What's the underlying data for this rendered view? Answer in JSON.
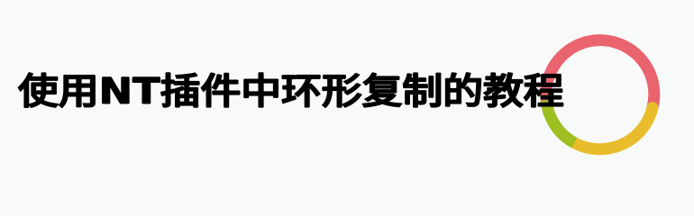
{
  "banner": {
    "title": "使用NT插件中环形复制的教程"
  },
  "ring": {
    "icon": "ring-logo-icon",
    "colors": {
      "red": "#ea6470",
      "yellow": "#e8bc2b",
      "green": "#9ebf22"
    }
  }
}
